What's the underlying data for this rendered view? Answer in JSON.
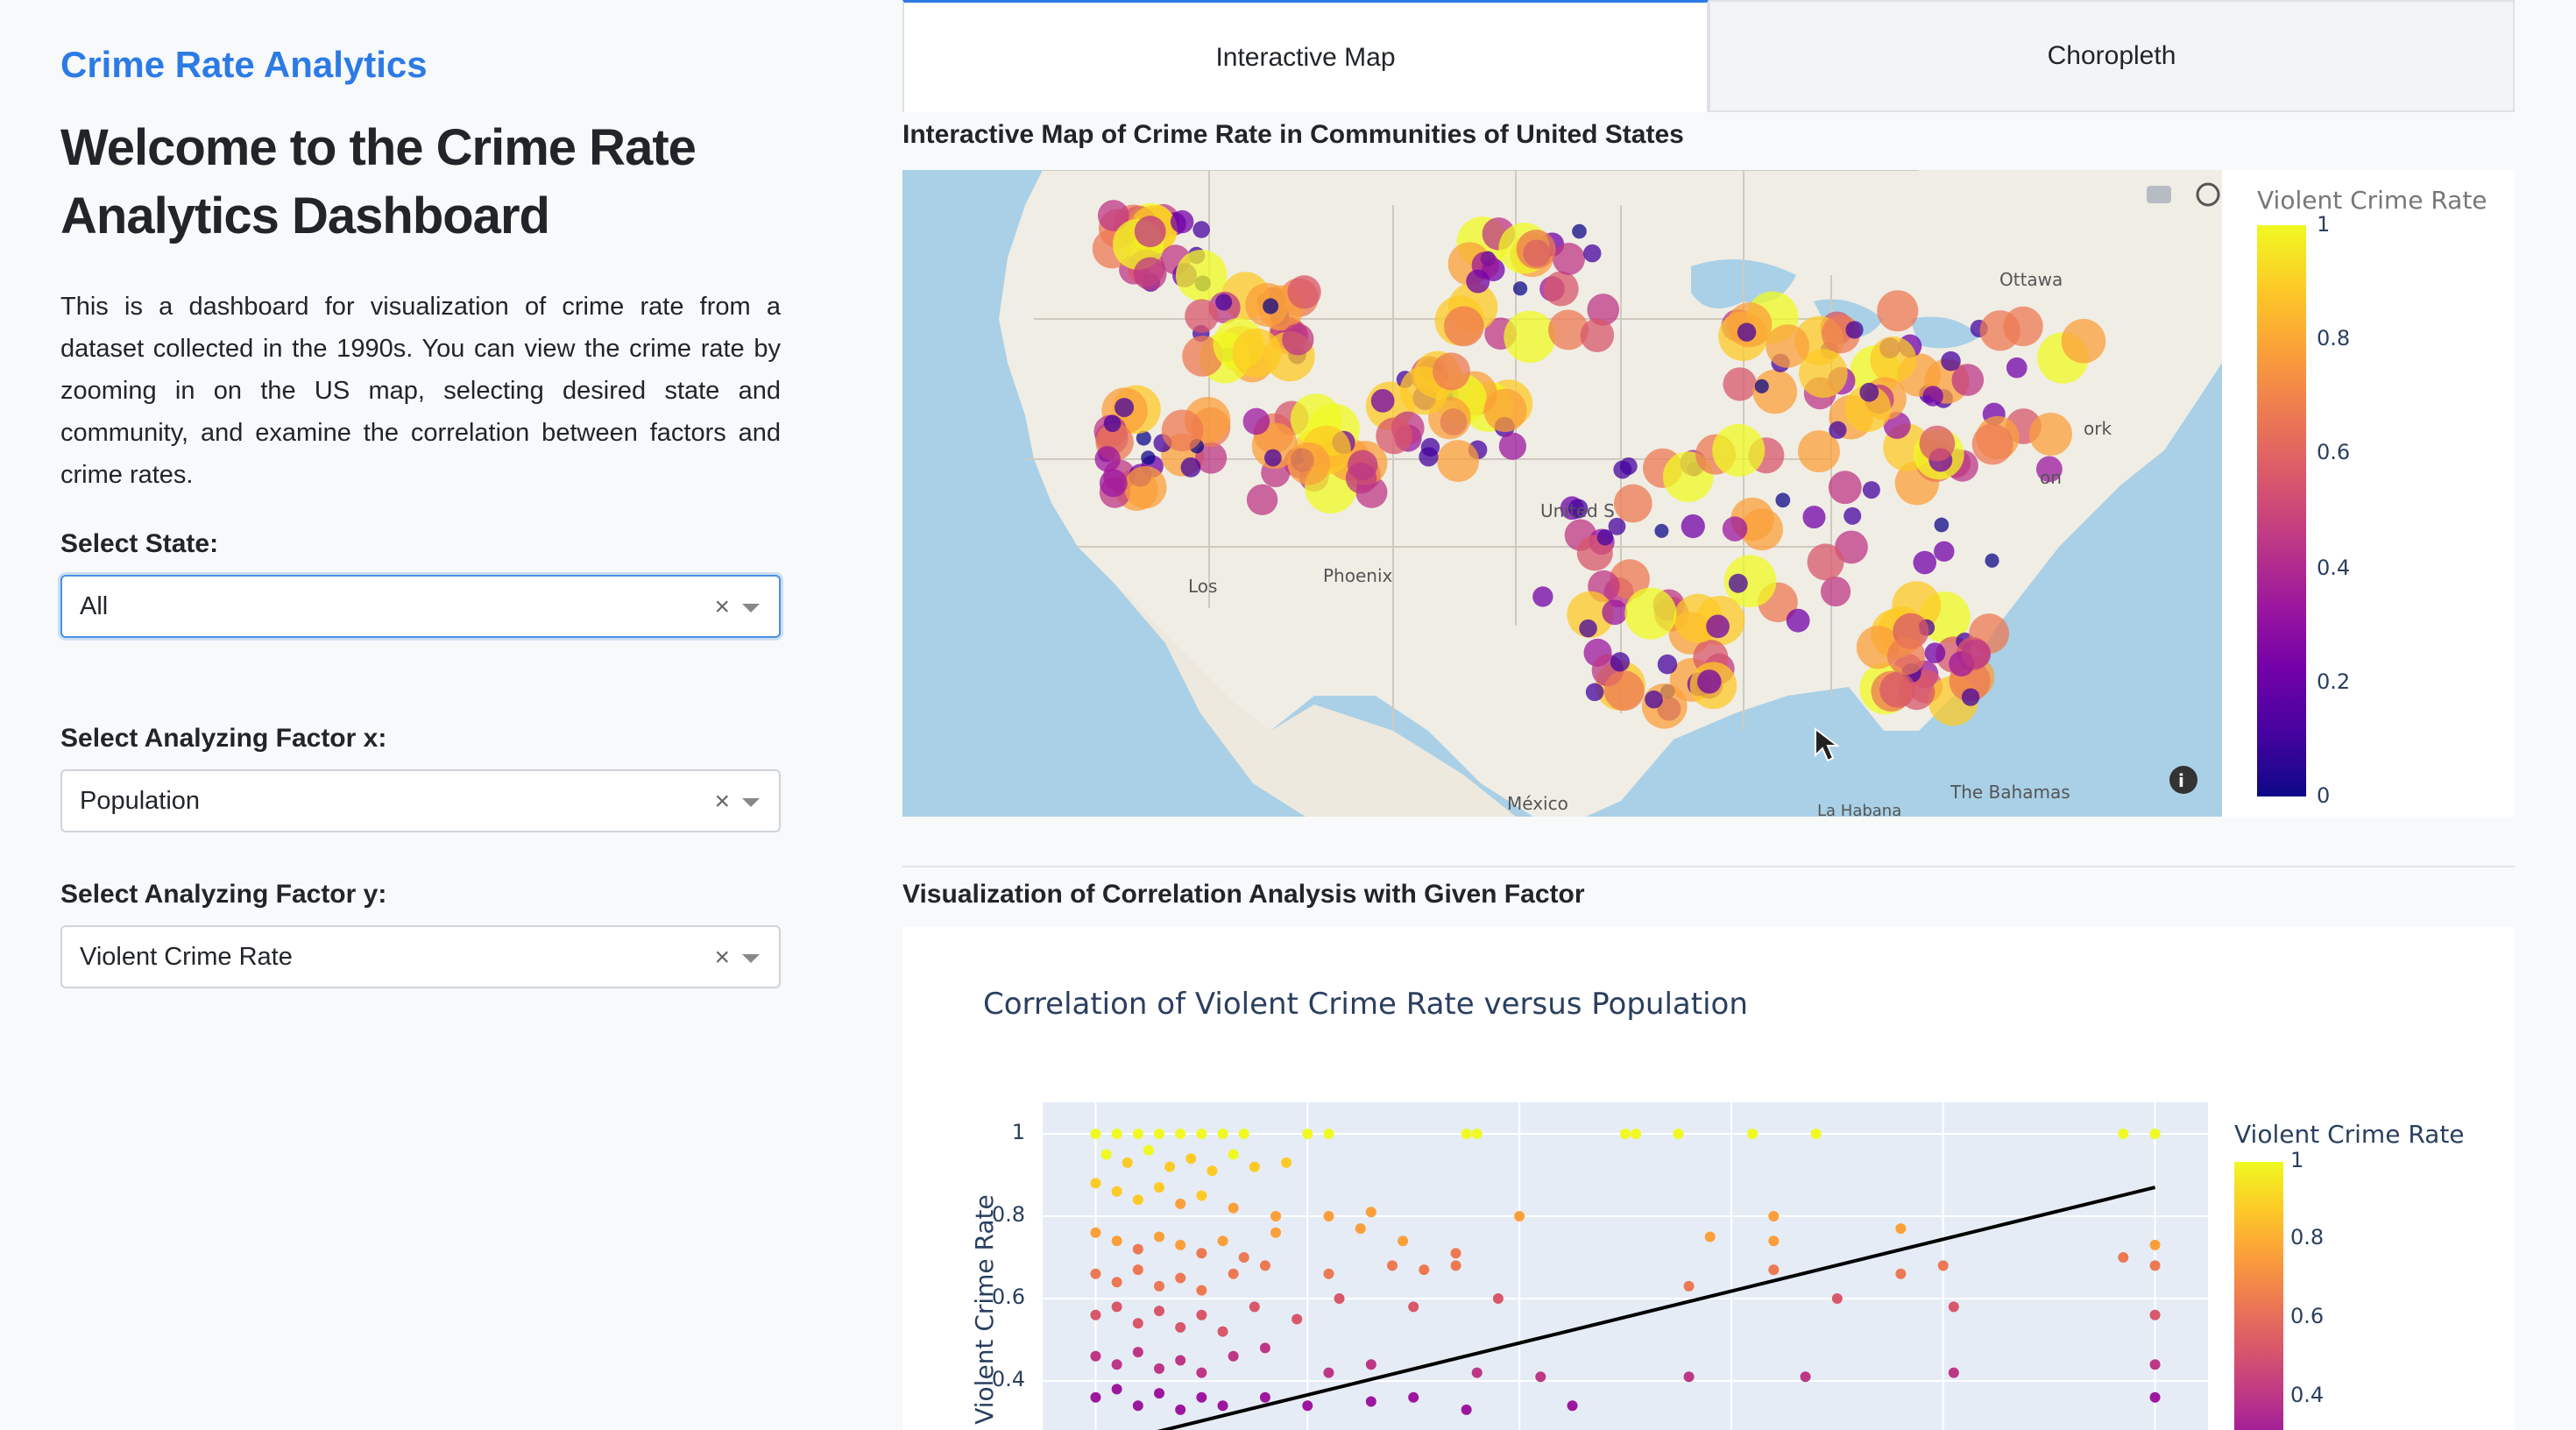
{
  "sidebar": {
    "brand": "Crime Rate Analytics",
    "welcome": "Welcome to the Crime Rate Analytics Dashboard",
    "description": "This is a dashboard for visualization of crime rate from a dataset collected in the 1990s. You can view the crime rate by zooming in on the US map, selecting desired state and community, and examine the correlation between factors and crime rates.",
    "state_label": "Select State:",
    "state_value": "All",
    "factor_x_label": "Select Analyzing Factor x:",
    "factor_x_value": "Population",
    "factor_y_label": "Select Analyzing Factor y:",
    "factor_y_value": "Violent Crime Rate",
    "clear_glyph": "×"
  },
  "tabs": [
    {
      "label": "Interactive Map",
      "active": true
    },
    {
      "label": "Choropleth",
      "active": false
    }
  ],
  "map_section": {
    "title": "Interactive Map of Crime Rate in Communities of United States",
    "colorbar_title": "Violent Crime Rate",
    "colorbar_ticks": [
      "1",
      "0.8",
      "0.6",
      "0.4",
      "0.2",
      "0"
    ],
    "place_labels": [
      "Ottawa",
      "Phoenix",
      "Los",
      "United S",
      "México",
      "La Habana",
      "The Bahamas",
      "ork",
      "on"
    ],
    "toolbar_icons": [
      "camera-icon",
      "pan-icon",
      "box-select-icon",
      "lasso-icon",
      "zoom-in-icon",
      "zoom-out-icon",
      "reset-icon",
      "plotly-logo-icon"
    ],
    "info_icon": "info-icon",
    "colorscale": [
      "#0d0887",
      "#46039f",
      "#7201a8",
      "#9c179e",
      "#bd3786",
      "#d8576b",
      "#ed7953",
      "#fb9f3a",
      "#fdca26",
      "#f0f921"
    ]
  },
  "correlation_section": {
    "title": "Visualization of Correlation Analysis with Given Factor"
  },
  "chart_data": {
    "type": "scatter",
    "title": "Correlation of Violent Crime Rate versus Population",
    "xlabel": "",
    "ylabel": "Violent Crime Rate",
    "y_ticks": [
      "1",
      "0.8",
      "0.6",
      "0.4"
    ],
    "ylim": [
      0.3,
      1.05
    ],
    "xlim": [
      -0.05,
      1.05
    ],
    "grid": true,
    "colorbar_title": "Violent Crime Rate",
    "colorbar_ticks": [
      "1",
      "0.8",
      "0.6",
      "0.4"
    ],
    "trendline": {
      "x": [
        0.0,
        1.0
      ],
      "y": [
        0.24,
        0.87
      ]
    },
    "points": [
      {
        "x": 0.0,
        "y": 1.0
      },
      {
        "x": 0.02,
        "y": 1.0
      },
      {
        "x": 0.04,
        "y": 1.0
      },
      {
        "x": 0.06,
        "y": 1.0
      },
      {
        "x": 0.08,
        "y": 1.0
      },
      {
        "x": 0.1,
        "y": 1.0
      },
      {
        "x": 0.12,
        "y": 1.0
      },
      {
        "x": 0.14,
        "y": 1.0
      },
      {
        "x": 0.2,
        "y": 1.0
      },
      {
        "x": 0.22,
        "y": 1.0
      },
      {
        "x": 0.35,
        "y": 1.0
      },
      {
        "x": 0.36,
        "y": 1.0
      },
      {
        "x": 0.5,
        "y": 1.0
      },
      {
        "x": 0.51,
        "y": 1.0
      },
      {
        "x": 0.55,
        "y": 1.0
      },
      {
        "x": 0.62,
        "y": 1.0
      },
      {
        "x": 0.68,
        "y": 1.0
      },
      {
        "x": 0.97,
        "y": 1.0
      },
      {
        "x": 1.0,
        "y": 1.0
      },
      {
        "x": 0.01,
        "y": 0.95
      },
      {
        "x": 0.03,
        "y": 0.93
      },
      {
        "x": 0.05,
        "y": 0.96
      },
      {
        "x": 0.07,
        "y": 0.92
      },
      {
        "x": 0.09,
        "y": 0.94
      },
      {
        "x": 0.11,
        "y": 0.91
      },
      {
        "x": 0.13,
        "y": 0.95
      },
      {
        "x": 0.15,
        "y": 0.92
      },
      {
        "x": 0.18,
        "y": 0.93
      },
      {
        "x": 0.0,
        "y": 0.88
      },
      {
        "x": 0.02,
        "y": 0.86
      },
      {
        "x": 0.04,
        "y": 0.84
      },
      {
        "x": 0.06,
        "y": 0.87
      },
      {
        "x": 0.08,
        "y": 0.83
      },
      {
        "x": 0.1,
        "y": 0.85
      },
      {
        "x": 0.13,
        "y": 0.82
      },
      {
        "x": 0.17,
        "y": 0.8
      },
      {
        "x": 0.22,
        "y": 0.8
      },
      {
        "x": 0.26,
        "y": 0.81
      },
      {
        "x": 0.4,
        "y": 0.8
      },
      {
        "x": 0.64,
        "y": 0.8
      },
      {
        "x": 0.0,
        "y": 0.76
      },
      {
        "x": 0.02,
        "y": 0.74
      },
      {
        "x": 0.04,
        "y": 0.72
      },
      {
        "x": 0.06,
        "y": 0.75
      },
      {
        "x": 0.08,
        "y": 0.73
      },
      {
        "x": 0.1,
        "y": 0.71
      },
      {
        "x": 0.12,
        "y": 0.74
      },
      {
        "x": 0.14,
        "y": 0.7
      },
      {
        "x": 0.17,
        "y": 0.76
      },
      {
        "x": 0.25,
        "y": 0.77
      },
      {
        "x": 0.29,
        "y": 0.74
      },
      {
        "x": 0.34,
        "y": 0.71
      },
      {
        "x": 0.58,
        "y": 0.75
      },
      {
        "x": 0.64,
        "y": 0.74
      },
      {
        "x": 0.76,
        "y": 0.77
      },
      {
        "x": 0.97,
        "y": 0.7
      },
      {
        "x": 1.0,
        "y": 0.73
      },
      {
        "x": 0.0,
        "y": 0.66
      },
      {
        "x": 0.02,
        "y": 0.64
      },
      {
        "x": 0.04,
        "y": 0.67
      },
      {
        "x": 0.06,
        "y": 0.63
      },
      {
        "x": 0.08,
        "y": 0.65
      },
      {
        "x": 0.1,
        "y": 0.62
      },
      {
        "x": 0.13,
        "y": 0.66
      },
      {
        "x": 0.16,
        "y": 0.68
      },
      {
        "x": 0.22,
        "y": 0.66
      },
      {
        "x": 0.28,
        "y": 0.68
      },
      {
        "x": 0.31,
        "y": 0.67
      },
      {
        "x": 0.34,
        "y": 0.68
      },
      {
        "x": 0.56,
        "y": 0.63
      },
      {
        "x": 0.64,
        "y": 0.67
      },
      {
        "x": 0.76,
        "y": 0.66
      },
      {
        "x": 0.8,
        "y": 0.68
      },
      {
        "x": 1.0,
        "y": 0.68
      },
      {
        "x": 0.0,
        "y": 0.56
      },
      {
        "x": 0.02,
        "y": 0.58
      },
      {
        "x": 0.04,
        "y": 0.54
      },
      {
        "x": 0.06,
        "y": 0.57
      },
      {
        "x": 0.08,
        "y": 0.53
      },
      {
        "x": 0.1,
        "y": 0.56
      },
      {
        "x": 0.12,
        "y": 0.52
      },
      {
        "x": 0.15,
        "y": 0.58
      },
      {
        "x": 0.19,
        "y": 0.55
      },
      {
        "x": 0.23,
        "y": 0.6
      },
      {
        "x": 0.3,
        "y": 0.58
      },
      {
        "x": 0.38,
        "y": 0.6
      },
      {
        "x": 0.7,
        "y": 0.6
      },
      {
        "x": 0.81,
        "y": 0.58
      },
      {
        "x": 1.0,
        "y": 0.56
      },
      {
        "x": 0.0,
        "y": 0.46
      },
      {
        "x": 0.02,
        "y": 0.44
      },
      {
        "x": 0.04,
        "y": 0.47
      },
      {
        "x": 0.06,
        "y": 0.43
      },
      {
        "x": 0.08,
        "y": 0.45
      },
      {
        "x": 0.1,
        "y": 0.42
      },
      {
        "x": 0.13,
        "y": 0.46
      },
      {
        "x": 0.16,
        "y": 0.48
      },
      {
        "x": 0.22,
        "y": 0.42
      },
      {
        "x": 0.26,
        "y": 0.44
      },
      {
        "x": 0.36,
        "y": 0.42
      },
      {
        "x": 0.42,
        "y": 0.41
      },
      {
        "x": 0.56,
        "y": 0.41
      },
      {
        "x": 0.67,
        "y": 0.41
      },
      {
        "x": 0.81,
        "y": 0.42
      },
      {
        "x": 1.0,
        "y": 0.44
      },
      {
        "x": 0.0,
        "y": 0.36
      },
      {
        "x": 0.02,
        "y": 0.38
      },
      {
        "x": 0.04,
        "y": 0.34
      },
      {
        "x": 0.06,
        "y": 0.37
      },
      {
        "x": 0.08,
        "y": 0.33
      },
      {
        "x": 0.1,
        "y": 0.36
      },
      {
        "x": 0.12,
        "y": 0.34
      },
      {
        "x": 0.16,
        "y": 0.36
      },
      {
        "x": 0.2,
        "y": 0.34
      },
      {
        "x": 0.26,
        "y": 0.35
      },
      {
        "x": 0.3,
        "y": 0.36
      },
      {
        "x": 0.35,
        "y": 0.33
      },
      {
        "x": 0.45,
        "y": 0.34
      },
      {
        "x": 1.0,
        "y": 0.36
      }
    ]
  }
}
